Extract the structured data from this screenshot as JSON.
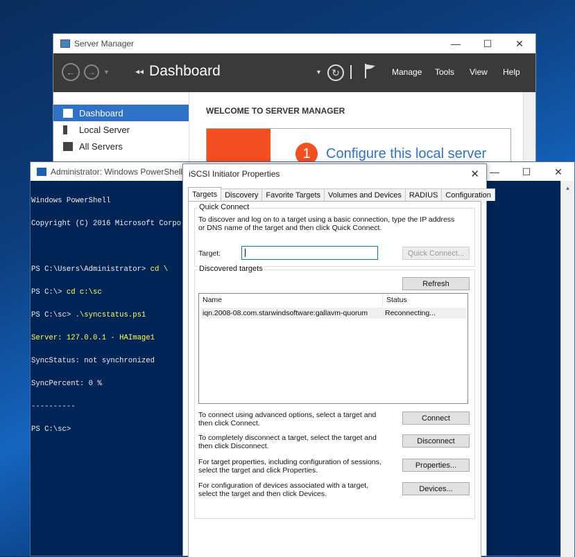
{
  "server_manager": {
    "title": "Server Manager",
    "window_controls": {
      "minimize": "—",
      "maximize": "☐",
      "close": "✕"
    },
    "breadcrumb_prefix": "◂◂",
    "breadcrumb": "Dashboard",
    "menus": [
      "Manage",
      "Tools",
      "View",
      "Help"
    ],
    "sidebar": [
      {
        "label": "Dashboard",
        "icon": "dashboard-icon",
        "active": true
      },
      {
        "label": "Local Server",
        "icon": "server-icon"
      },
      {
        "label": "All Servers",
        "icon": "servers-icon"
      }
    ],
    "welcome_title": "WELCOME TO SERVER MANAGER",
    "quick_start_number": "1",
    "quick_start_link": "Configure this local server",
    "accent_color": "#f25022",
    "link_color": "#2e72c9"
  },
  "powershell": {
    "title": "Administrator: Windows PowerShell",
    "window_controls": {
      "minimize": "—",
      "maximize": "☐",
      "close": "✕"
    },
    "lines": [
      {
        "prompt": "Windows PowerShell",
        "cmd": ""
      },
      {
        "prompt": "Copyright (C) 2016 Microsoft Corpo",
        "cmd": ""
      },
      {
        "prompt": "",
        "cmd": ""
      },
      {
        "prompt": "PS C:\\Users\\Administrator> ",
        "cmd": "cd \\"
      },
      {
        "prompt": "PS C:\\> ",
        "cmd": "cd c:\\sc"
      },
      {
        "prompt": "PS C:\\sc> ",
        "cmd": ".\\syncstatus.ps1"
      },
      {
        "prompt": "",
        "cmd": "Server: 127.0.0.1 - HAImage1"
      },
      {
        "prompt": "SyncStatus: not synchronized",
        "cmd": ""
      },
      {
        "prompt": "SyncPercent: 0 %",
        "cmd": ""
      },
      {
        "prompt": "----------",
        "cmd": ""
      },
      {
        "prompt": "PS C:\\sc>",
        "cmd": ""
      }
    ]
  },
  "iscsi": {
    "title": "iSCSI Initiator Properties",
    "close": "✕",
    "tabs": [
      "Targets",
      "Discovery",
      "Favorite Targets",
      "Volumes and Devices",
      "RADIUS",
      "Configuration"
    ],
    "quick_connect": {
      "label": "Quick Connect",
      "description": "To discover and log on to a target using a basic connection, type the IP address or DNS name of the target and then click Quick Connect.",
      "target_label": "Target:",
      "target_value": "",
      "button": "Quick Connect..."
    },
    "discovered": {
      "label": "Discovered targets",
      "refresh": "Refresh",
      "columns": [
        "Name",
        "Status"
      ],
      "rows": [
        {
          "name": "iqn.2008-08.com.starwindsoftware:gallavm-quorum",
          "status": "Reconnecting..."
        }
      ]
    },
    "actions": [
      {
        "text": "To connect using advanced options, select a target and then click Connect.",
        "button": "Connect"
      },
      {
        "text": "To completely disconnect a target, select the target and then click Disconnect.",
        "button": "Disconnect"
      },
      {
        "text": "For target properties, including configuration of sessions, select the target and click Properties.",
        "button": "Properties..."
      },
      {
        "text": "For configuration of devices associated with a target, select the target and then click Devices.",
        "button": "Devices..."
      }
    ]
  }
}
